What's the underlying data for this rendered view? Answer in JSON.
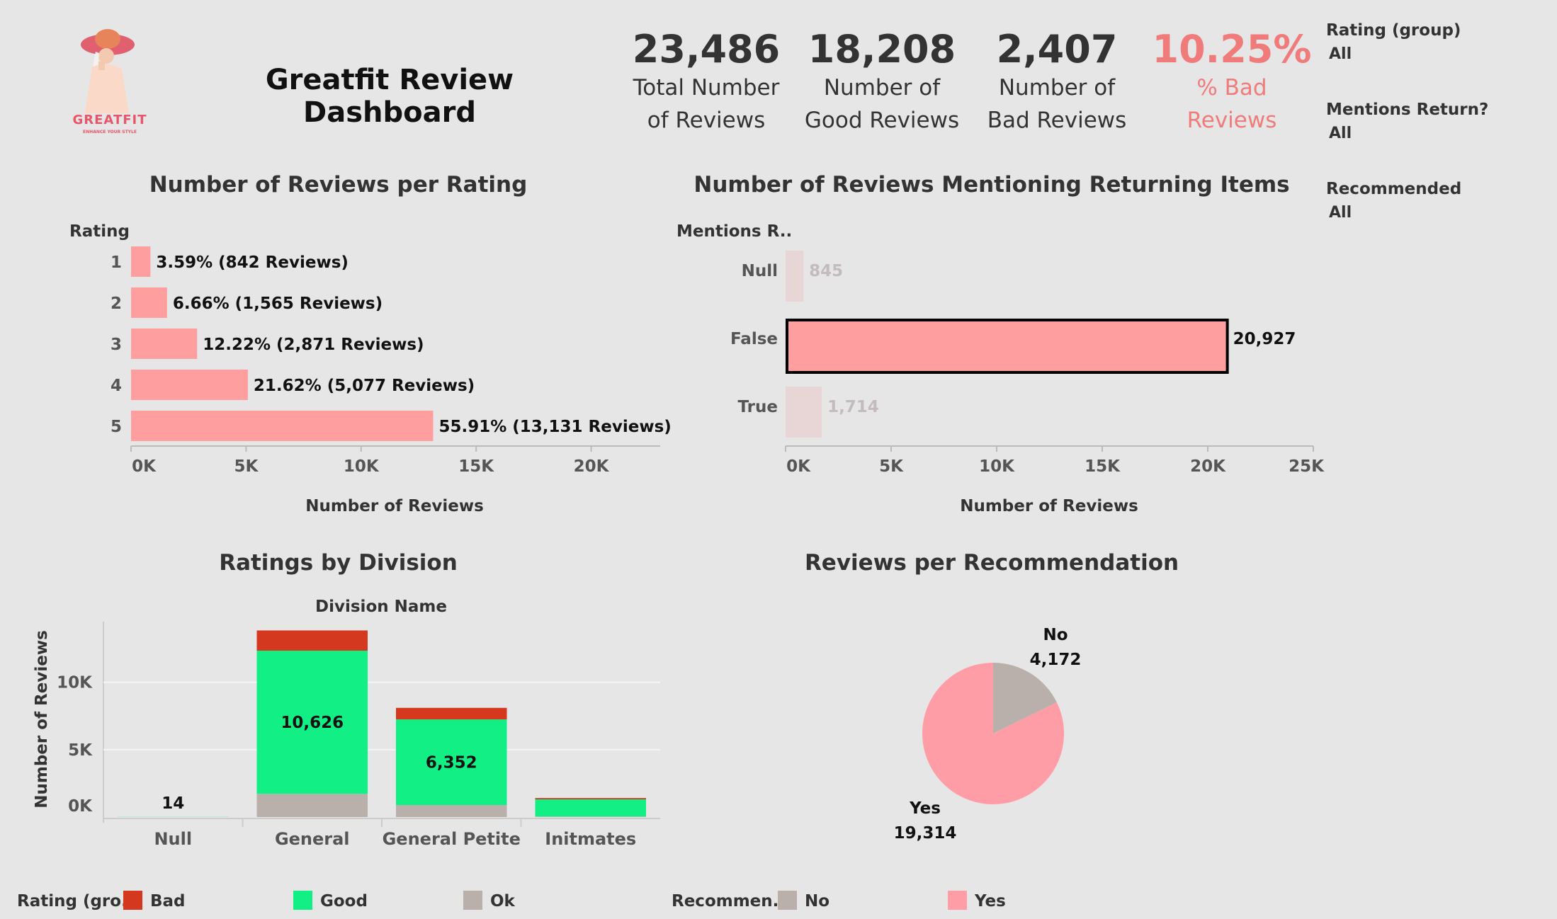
{
  "header": {
    "title": "Greatfit Review Dashboard",
    "logo_text": "GREATFIT",
    "logo_tagline": "ENHANCE YOUR STYLE"
  },
  "kpis": [
    {
      "value": "23,486",
      "label_line1": "Total Number",
      "label_line2": "of Reviews"
    },
    {
      "value": "18,208",
      "label_line1": "Number of",
      "label_line2": "Good Reviews"
    },
    {
      "value": "2,407",
      "label_line1": "Number of",
      "label_line2": "Bad Reviews"
    },
    {
      "value": "10.25%",
      "label_line1": "% Bad",
      "label_line2": "Reviews"
    }
  ],
  "colors": {
    "accent": "#f07b7b",
    "bar": "#ff9e9e",
    "bar_faded": "#e8d6d6",
    "good": "#12ef85",
    "bad": "#d4391f",
    "ok": "#bab0ab",
    "pie_yes": "#ff9da7",
    "pie_no": "#bab0ab"
  },
  "filters": [
    {
      "title": "Rating (group)",
      "value": "All"
    },
    {
      "title": "Mentions Return?",
      "value": "All"
    },
    {
      "title": "Recommended",
      "value": "All"
    }
  ],
  "legends": {
    "rating": {
      "title": "Rating (gro..",
      "items": [
        "Bad",
        "Good",
        "Ok"
      ]
    },
    "recommend": {
      "title": "Recommen..",
      "items": [
        "No",
        "Yes"
      ]
    }
  },
  "chart_data": [
    {
      "type": "bar",
      "orientation": "horizontal",
      "title": "Number of Reviews per Rating",
      "category_header": "Rating",
      "categories": [
        "1",
        "2",
        "3",
        "4",
        "5"
      ],
      "values": [
        842,
        1565,
        2871,
        5077,
        13131
      ],
      "data_labels": [
        "3.59% (842 Reviews)",
        "6.66% (1,565 Reviews)",
        "12.22% (2,871 Reviews)",
        "21.62% (5,077 Reviews)",
        "55.91% (13,131 Reviews)"
      ],
      "xlabel": "Number of Reviews",
      "xticks": [
        "0K",
        "5K",
        "10K",
        "15K",
        "20K"
      ],
      "xlim": [
        0,
        23000
      ]
    },
    {
      "type": "bar",
      "orientation": "horizontal",
      "title": "Number of Reviews Mentioning Returning Items",
      "category_header": "Mentions R..",
      "categories": [
        "Null",
        "False",
        "True"
      ],
      "values": [
        845,
        20927,
        1714
      ],
      "data_labels": [
        "845",
        "20,927",
        "1,714"
      ],
      "highlighted": "False",
      "xlabel": "Number of Reviews",
      "xticks": [
        "0K",
        "5K",
        "10K",
        "15K",
        "20K",
        "25K"
      ],
      "xlim": [
        0,
        25000
      ]
    },
    {
      "type": "bar",
      "stacked": true,
      "title": "Ratings by Division",
      "category_header": "Division Name",
      "categories": [
        "Null",
        "General",
        "General Petite",
        "Initmates"
      ],
      "ylabel": "Number of Reviews",
      "yticks": [
        "0K",
        "5K",
        "10K"
      ],
      "ylim": [
        0,
        14500
      ],
      "series": [
        {
          "name": "Ok",
          "values": [
            2,
            1720,
            890,
            40
          ]
        },
        {
          "name": "Good",
          "values": [
            12,
            10626,
            6352,
            1270
          ]
        },
        {
          "name": "Bad",
          "values": [
            0,
            1500,
            860,
            100
          ]
        }
      ],
      "data_labels": [
        "14",
        "10,626",
        "6,352",
        ""
      ]
    },
    {
      "type": "pie",
      "title": "Reviews per Recommendation",
      "labels": [
        "No",
        "Yes"
      ],
      "values": [
        4172,
        19314
      ],
      "data_labels": [
        "4,172",
        "19,314"
      ]
    }
  ]
}
